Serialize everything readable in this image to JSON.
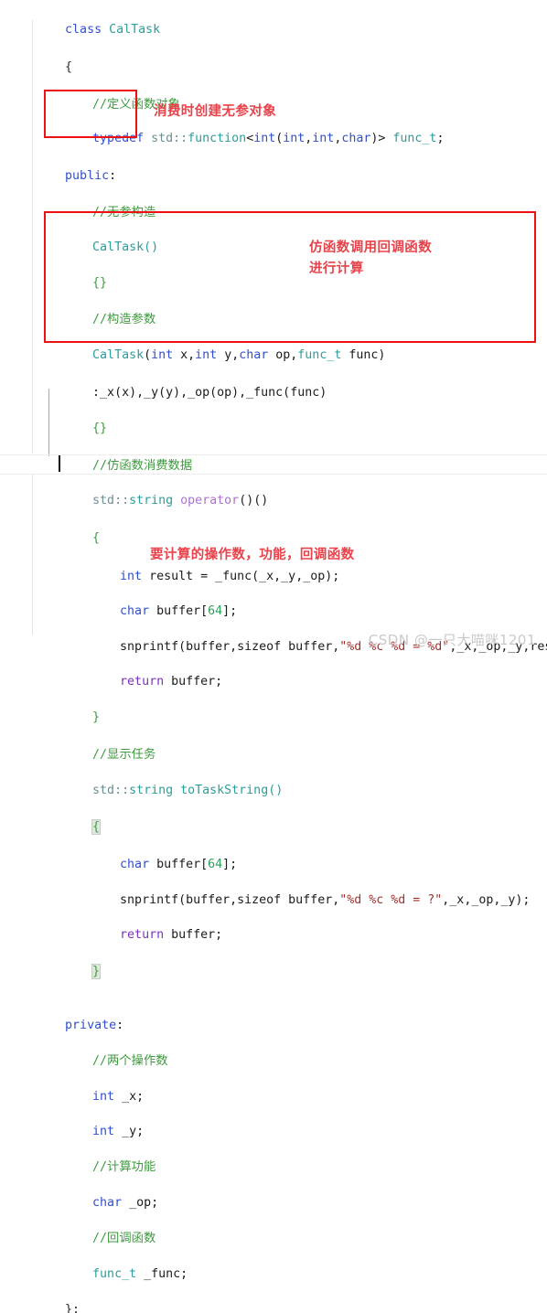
{
  "editor": {
    "language": "C++",
    "theme": "light",
    "background": "#ffffff",
    "annotation_color": "#ee1111",
    "note_color": "#e8424a"
  },
  "code_lines": [
    {
      "indent": 0,
      "text": "class CalTask"
    },
    {
      "indent": 0,
      "text": "{"
    },
    {
      "indent": 1,
      "text": "//定义函数对象"
    },
    {
      "indent": 1,
      "text": "typedef std::function<int(int,int,char)> func_t;"
    },
    {
      "indent": 0,
      "text": "public:"
    },
    {
      "indent": 1,
      "text": "//无参构造"
    },
    {
      "indent": 1,
      "text": "CalTask()"
    },
    {
      "indent": 1,
      "text": "{}"
    },
    {
      "indent": 1,
      "text": "//构造参数"
    },
    {
      "indent": 1,
      "text": "CalTask(int x,int y,char op,func_t func)"
    },
    {
      "indent": 1,
      "text": ":_x(x),_y(y),_op(op),_func(func)"
    },
    {
      "indent": 1,
      "text": "{}"
    },
    {
      "indent": 1,
      "text": "//仿函数消费数据"
    },
    {
      "indent": 1,
      "text": "std::string operator()()"
    },
    {
      "indent": 1,
      "text": "{"
    },
    {
      "indent": 2,
      "text": "int result = _func(_x,_y,_op);"
    },
    {
      "indent": 2,
      "text": "char buffer[64];"
    },
    {
      "indent": 2,
      "text": "snprintf(buffer,sizeof buffer,\"%d %c %d = %d\",_x,_op,_y,result);"
    },
    {
      "indent": 2,
      "text": "return buffer;"
    },
    {
      "indent": 1,
      "text": "}"
    },
    {
      "indent": 1,
      "text": "//显示任务"
    },
    {
      "indent": 1,
      "text": "std::string toTaskString()"
    },
    {
      "indent": 1,
      "text": "{"
    },
    {
      "indent": 2,
      "text": "char buffer[64];"
    },
    {
      "indent": 2,
      "text": "snprintf(buffer,sizeof buffer,\"%d %c %d = ?\",_x,_op,_y);"
    },
    {
      "indent": 2,
      "text": "return buffer;"
    },
    {
      "indent": 1,
      "text": "}"
    },
    {
      "indent": 0,
      "text": ""
    },
    {
      "indent": 0,
      "text": "private:"
    },
    {
      "indent": 1,
      "text": "//两个操作数"
    },
    {
      "indent": 1,
      "text": "int _x;"
    },
    {
      "indent": 1,
      "text": "int _y;"
    },
    {
      "indent": 1,
      "text": "//计算功能"
    },
    {
      "indent": 1,
      "text": "char _op;"
    },
    {
      "indent": 1,
      "text": "//回调函数"
    },
    {
      "indent": 1,
      "text": "func_t _func;"
    },
    {
      "indent": 0,
      "text": "};"
    }
  ],
  "tokens": {
    "l0_kw": "class",
    "l0_name": " CalTask",
    "l1": "{",
    "l2_cmt": "//定义函数对象",
    "l3_kw": "typedef",
    "l3_ns": "std::",
    "l3_type": "function",
    "l3_lt": "<",
    "l3_int1": "int",
    "l3_p1": "(",
    "l3_int2": "int",
    "l3_c1": ",",
    "l3_int3": "int",
    "l3_c2": ",",
    "l3_char": "char",
    "l3_p2": ")",
    "l3_gt": "> ",
    "l3_ft": "func_t",
    "l3_semi": ";",
    "l4_kw": "public",
    "l4_colon": ":",
    "l5_cmt": "//无参构造",
    "l6_name": "CalTask()",
    "l7_brc": "{}",
    "l8_cmt": "//构造参数",
    "l9_name": "CalTask",
    "l9_p1": "(",
    "l9_int1": "int",
    "l9_x": " x,",
    "l9_int2": "int",
    "l9_y": " y,",
    "l9_char": "char",
    "l9_op": " op,",
    "l9_ft": "func_t",
    "l9_func": " func)",
    "l10_init": ":_x(x),_y(y),_op(op),_func(func)",
    "l11_brc": "{}",
    "l12_cmt": "//仿函数消费数据",
    "l13_ns": "std::",
    "l13_type": "string",
    "l13_sp": " ",
    "l13_op": "operator",
    "l13_tail": "()()",
    "l14_brc": "{",
    "l15_int": "int",
    "l15_rest": " result = _func(_x,_y,_op);",
    "l16_char": "char",
    "l16_buf": " buffer[",
    "l16_num": "64",
    "l16_end": "];",
    "l17_call": "snprintf(buffer,sizeof buffer,",
    "l17_str": "\"%d %c %d = %d\"",
    "l17_args": ",_x,_op,_y,result);",
    "l18_ret": "return",
    "l18_buf": " buffer;",
    "l19_brc": "}",
    "l20_cmt": "//显示任务",
    "l21_ns": "std::",
    "l21_type": "string",
    "l21_name": " toTaskString()",
    "l22_brc": "{",
    "l23_char": "char",
    "l23_buf": " buffer[",
    "l23_num": "64",
    "l23_end": "];",
    "l24_call": "snprintf(buffer,sizeof buffer,",
    "l24_str": "\"%d %c %d = ?\"",
    "l24_args": ",_x,_op,_y);",
    "l25_ret": "return",
    "l25_buf": " buffer;",
    "l26_brc": "}",
    "l28_kw": "private",
    "l28_colon": ":",
    "l29_cmt": "//两个操作数",
    "l30_int": "int",
    "l30_var": " _x;",
    "l31_int": "int",
    "l31_var": " _y;",
    "l32_cmt": "//计算功能",
    "l33_char": "char",
    "l33_var": " _op;",
    "l34_cmt": "//回调函数",
    "l35_ft": "func_t",
    "l35_var": " _func;",
    "l36_end": "};"
  },
  "annotations": [
    {
      "id": "note-1",
      "text": "消费时创建无参对象"
    },
    {
      "id": "note-2",
      "text": "仿函数调用回调函数"
    },
    {
      "id": "note-3",
      "text": "进行计算"
    },
    {
      "id": "note-4",
      "text": "要计算的操作数，功能，回调函数"
    }
  ],
  "highlight_boxes": [
    {
      "id": "box-default-ctor",
      "label": "default-constructor-highlight"
    },
    {
      "id": "box-operator",
      "label": "functor-operator-highlight"
    }
  ],
  "watermark": {
    "text": "CSDN @一只大喵咪1201"
  }
}
